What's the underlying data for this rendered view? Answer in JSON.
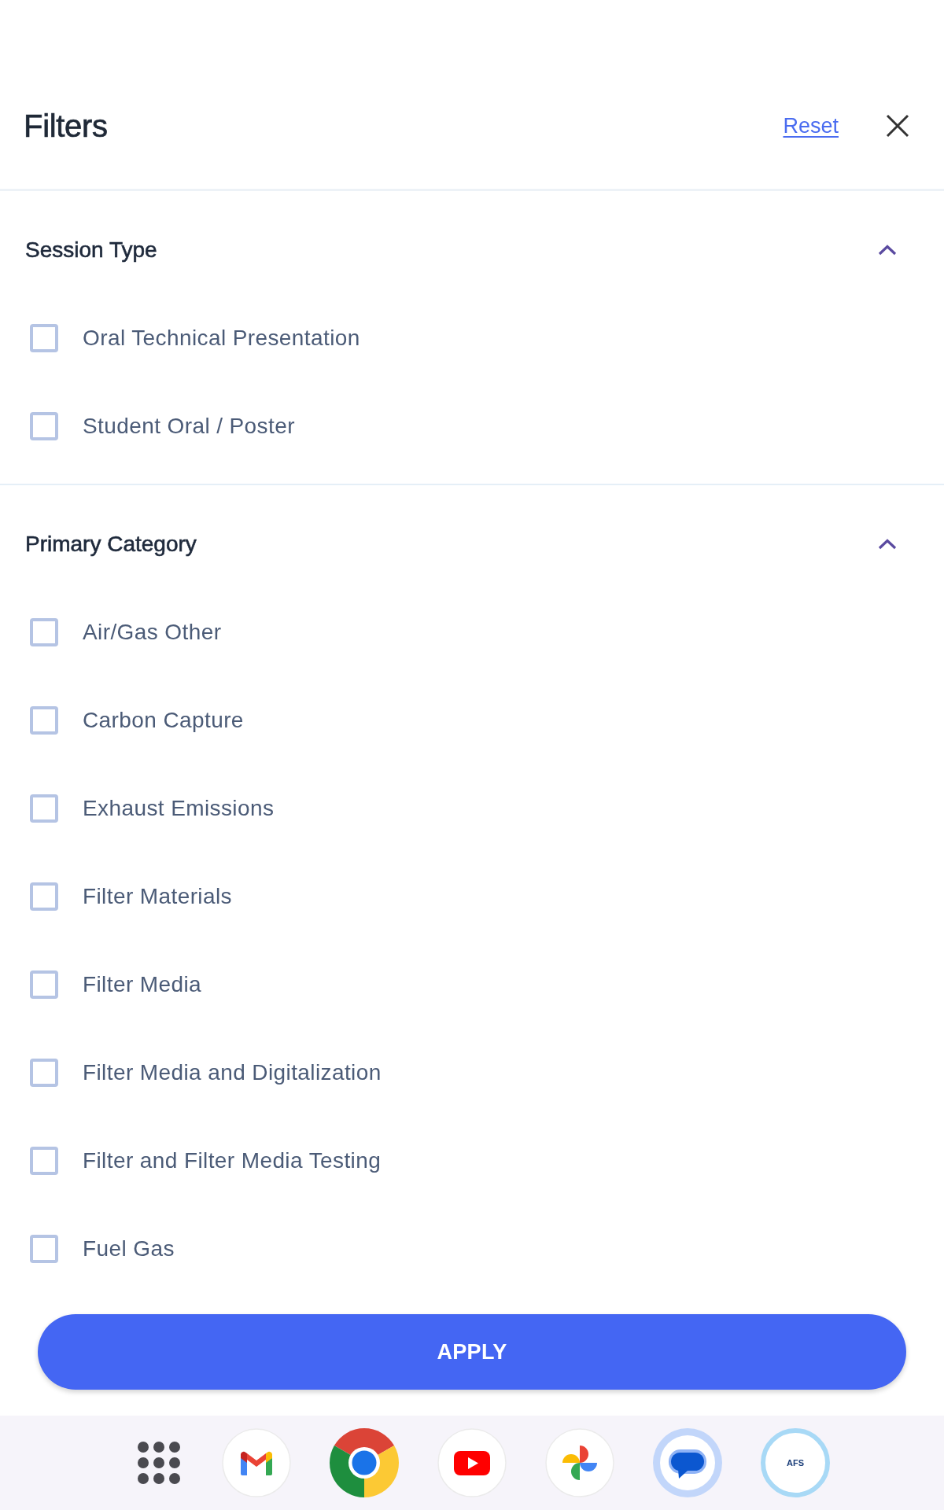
{
  "header": {
    "title": "Filters",
    "reset_label": "Reset"
  },
  "sections": [
    {
      "title": "Session Type",
      "expanded": true,
      "options": [
        {
          "label": "Oral Technical Presentation",
          "checked": false
        },
        {
          "label": "Student Oral / Poster",
          "checked": false
        }
      ]
    },
    {
      "title": "Primary Category",
      "expanded": true,
      "options": [
        {
          "label": "Air/Gas Other",
          "checked": false
        },
        {
          "label": "Carbon Capture",
          "checked": false
        },
        {
          "label": "Exhaust Emissions",
          "checked": false
        },
        {
          "label": "Filter Materials",
          "checked": false
        },
        {
          "label": "Filter Media",
          "checked": false
        },
        {
          "label": "Filter Media and Digitalization",
          "checked": false
        },
        {
          "label": "Filter and Filter Media Testing",
          "checked": false
        },
        {
          "label": "Fuel Gas",
          "checked": false
        }
      ]
    }
  ],
  "apply_button": {
    "label": "APPLY"
  },
  "dock": {
    "logo_text": "AFS"
  }
}
